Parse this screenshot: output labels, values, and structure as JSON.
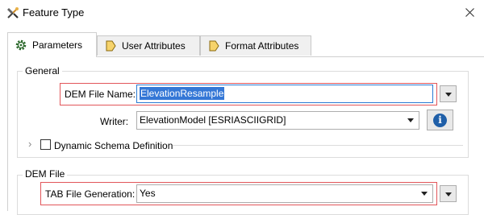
{
  "window": {
    "title": "Feature Type",
    "app_icon": "fme-workbench-icon",
    "close_icon": "close-icon"
  },
  "tabs": [
    {
      "label": "Parameters",
      "icon": "gear-icon",
      "active": true
    },
    {
      "label": "User Attributes",
      "icon": "tag-arrow-icon",
      "active": false
    },
    {
      "label": "Format Attributes",
      "icon": "tag-arrow-icon",
      "active": false
    }
  ],
  "general": {
    "title": "General",
    "dem_file_name": {
      "label": "DEM File Name:",
      "value": "ElevationResample"
    },
    "writer": {
      "label": "Writer:",
      "value": "ElevationModel [ESRIASCIIGRID]"
    },
    "dynamic_schema": {
      "label": "Dynamic Schema Definition",
      "checked": false
    }
  },
  "dem_file": {
    "title": "DEM File",
    "tab_file_generation": {
      "label": "TAB File Generation:",
      "value": "Yes"
    }
  },
  "colors": {
    "highlight_border": "#e2565a",
    "selection": "#3477d6",
    "info": "#1f5fa8"
  }
}
